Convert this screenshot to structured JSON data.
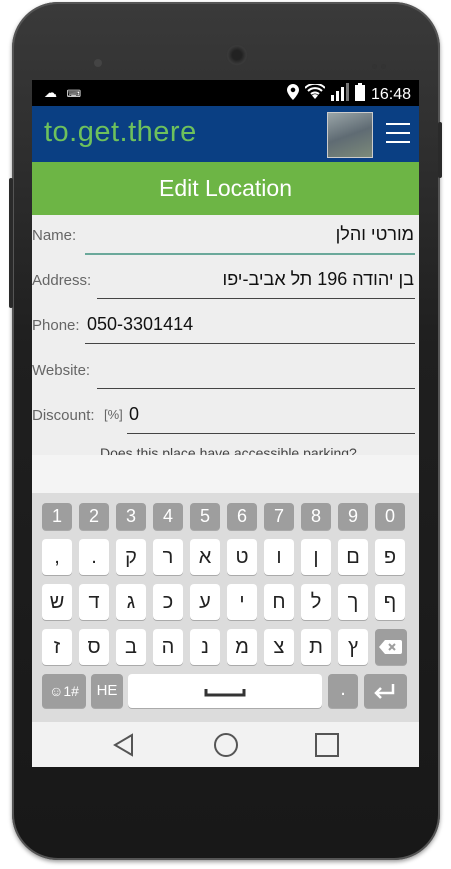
{
  "status": {
    "time": "16:48"
  },
  "app": {
    "logo": "to.get.there"
  },
  "header": {
    "title": "Edit Location"
  },
  "form": {
    "name_label": "Name:",
    "name_value": "מורטי והלן",
    "address_label": "Address:",
    "address_value": "בן יהודה 196 תל אביב-יפו",
    "phone_label": "Phone:",
    "phone_value": "050-3301414",
    "website_label": "Website:",
    "website_value": "",
    "discount_label": "Discount:",
    "discount_unit": "[%]",
    "discount_value": "0",
    "parking_question": "Does this place have accessible parking?"
  },
  "keyboard": {
    "numbers": [
      "1",
      "2",
      "3",
      "4",
      "5",
      "6",
      "7",
      "8",
      "9",
      "0"
    ],
    "row1": [
      ",",
      ".",
      "ק",
      "ר",
      "א",
      "ט",
      "ו",
      "ן",
      "ם",
      "פ"
    ],
    "row2": [
      "ש",
      "ד",
      "ג",
      "כ",
      "ע",
      "י",
      "ח",
      "ל",
      "ך",
      "ף"
    ],
    "row3": [
      "ז",
      "ס",
      "ב",
      "ה",
      "נ",
      "מ",
      "צ",
      "ת",
      "ץ"
    ],
    "symbols_label": "☺1#",
    "lang_label": "HE",
    "period_label": "."
  },
  "icons": [
    "cloud-icon",
    "keyboard-icon",
    "location-icon",
    "wifi-icon",
    "signal-icon",
    "battery-icon",
    "menu-icon",
    "backspace-icon",
    "space-icon",
    "enter-icon",
    "back-icon",
    "home-icon",
    "recents-icon"
  ]
}
